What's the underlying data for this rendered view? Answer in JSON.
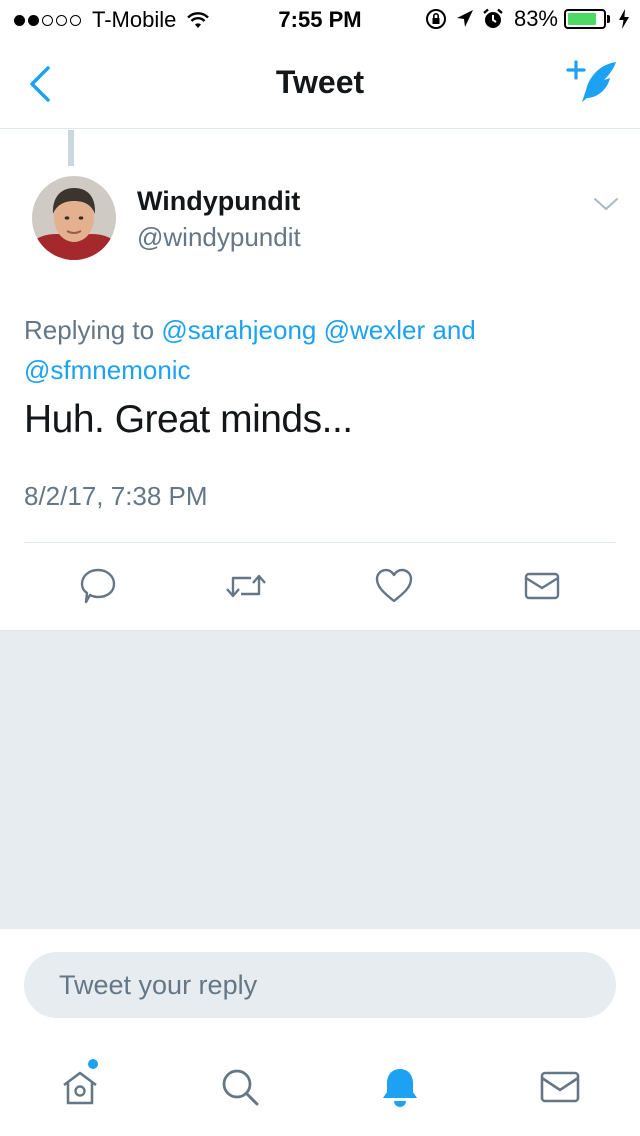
{
  "status_bar": {
    "carrier": "T-Mobile",
    "time": "7:55 PM",
    "battery_percent": "83%",
    "battery_level": 0.83,
    "signal_bars_filled": 2,
    "signal_bars_total": 5,
    "battery_color": "#4cd964"
  },
  "nav": {
    "title": "Tweet",
    "back_icon": "chevron-left-icon",
    "compose_icon": "compose-tweet-icon",
    "accent_color": "#1da1f2"
  },
  "tweet": {
    "author_name": "Windypundit",
    "author_handle": "@windypundit",
    "replying_prefix": "Replying to",
    "mentions": [
      "@sarahjeong",
      "@wexler",
      "@sfmnemonic"
    ],
    "mention_joiner": "and",
    "text": "Huh. Great minds...",
    "timestamp": "8/2/17, 7:38 PM"
  },
  "actions": [
    {
      "name": "reply-button",
      "icon": "reply-icon"
    },
    {
      "name": "retweet-button",
      "icon": "retweet-icon"
    },
    {
      "name": "like-button",
      "icon": "heart-icon"
    },
    {
      "name": "dm-share-button",
      "icon": "envelope-icon"
    }
  ],
  "reply_bar": {
    "placeholder": "Tweet your reply"
  },
  "tab_bar": [
    {
      "name": "tab-home",
      "icon": "home-icon",
      "has_badge": true,
      "active": false
    },
    {
      "name": "tab-search",
      "icon": "search-icon",
      "active": false
    },
    {
      "name": "tab-notifications",
      "icon": "bell-icon",
      "active": true
    },
    {
      "name": "tab-messages",
      "icon": "envelope-icon",
      "active": false
    }
  ]
}
